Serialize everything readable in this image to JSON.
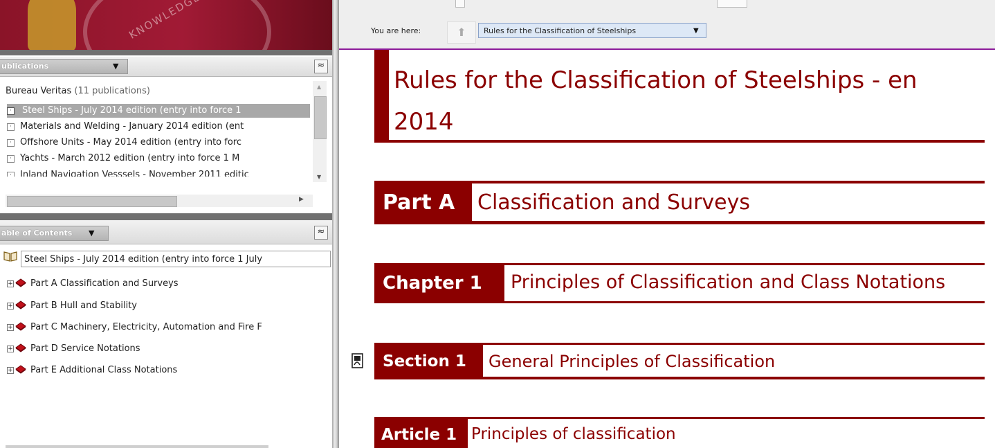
{
  "breadcrumb": {
    "label": "You are here:",
    "current": "Rules for the Classification of Steelships"
  },
  "publications_panel": {
    "title": "ublications",
    "group": "Bureau Veritas",
    "group_count": "(11 publications)",
    "items": [
      "Steel Ships - July 2014 edition (entry into force 1",
      "Materials and Welding - January 2014 edition (ent",
      "Offshore Units - May 2014 edition (entry into forc",
      "Yachts - March 2012 edition (entry into force 1 M",
      "Inland Navigation Vesssels - November 2011 editic"
    ]
  },
  "toc_panel": {
    "title": "able of Contents",
    "root": "Steel Ships - July 2014 edition (entry into force 1 July",
    "items": [
      "Part A Classification and Surveys",
      "Part B Hull and Stability",
      "Part C Machinery, Electricity, Automation and Fire F",
      "Part D Service Notations",
      "Part E Additional Class Notations"
    ]
  },
  "document": {
    "title_line1": "Rules for the Classification of Steelships - en",
    "title_line2": "2014",
    "part_label": "Part A",
    "part_title": "Classification and Surveys",
    "chapter_label": "Chapter 1",
    "chapter_title": "Principles of Classification and Class Notations",
    "section_label": "Section 1",
    "section_title": "General Principles of Classification",
    "article_label": "Article 1",
    "article_title": "Principles of classification"
  },
  "colors": {
    "accent": "#8b0000",
    "banner": "#a11a35",
    "selected": "#a8a8a8"
  }
}
